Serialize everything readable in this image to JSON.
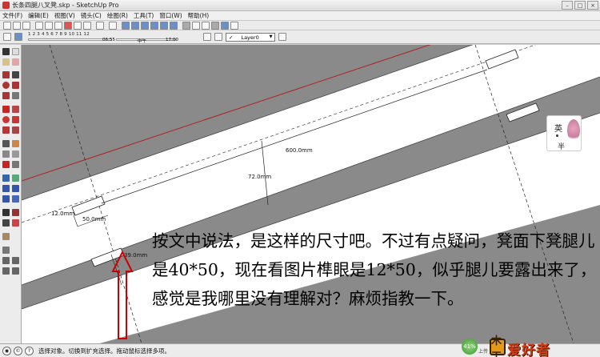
{
  "window": {
    "title": "长条四腿八叉凳.skp - SketchUp Pro",
    "controls": [
      "–",
      "□",
      "×"
    ]
  },
  "menu": [
    "文件(F)",
    "编辑(E)",
    "视图(V)",
    "镜头(C)",
    "绘图(R)",
    "工具(T)",
    "窗口(W)",
    "帮助(H)"
  ],
  "shadow_toolbar": {
    "months": "1  2  3  4  5  6  7  8  9 10 11 12",
    "time_left": "06:55",
    "time_mid": "中午",
    "time_right": "17:00"
  },
  "layer": {
    "current": "Layer0",
    "check": "✓"
  },
  "dimensions": {
    "length": "600.0mm",
    "width": "72.0mm",
    "small_a": "12.0mm",
    "small_b": "50.0mm",
    "small_c": "39.0mm"
  },
  "ime": {
    "lang": "英",
    "mode": "半"
  },
  "overlay_text": "按文中说法，是这样的尺寸吧。不过有点疑问，凳面下凳腿儿是40*50，现在看图片榫眼是12*50，似乎腿儿要露出来了，感觉是我哪里没有理解对？麻烦指教一下。",
  "status": {
    "message": "选择对象。切换到扩充选择。拖动鼠标选择多项。",
    "percent": "41%",
    "net": "上传 0K",
    "logo_mark": "木工",
    "logo_text": "爱好者"
  },
  "colors": {
    "viewport_bg": "#8a8a8a",
    "board": "#ffffff",
    "red_axis": "#b22222",
    "arrow": "#cc0000",
    "logo": "#d23a12"
  }
}
